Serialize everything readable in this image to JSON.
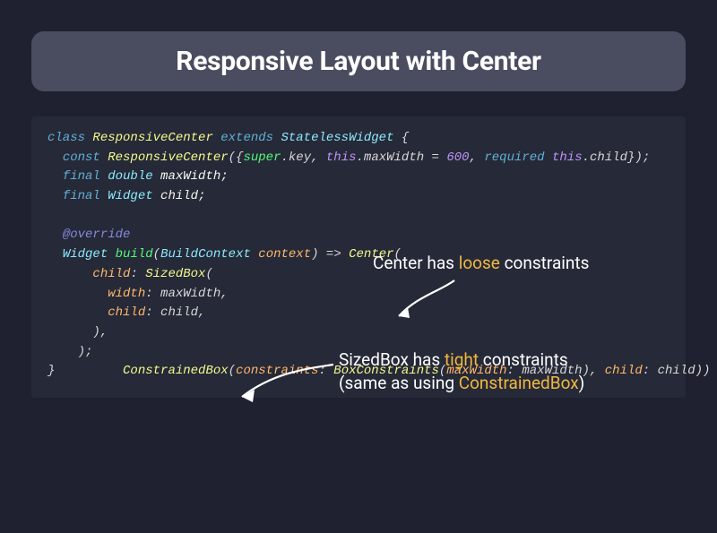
{
  "title": "Responsive Layout with Center",
  "code": {
    "l1_class": "class",
    "l1_name": "ResponsiveCenter",
    "l1_ext": "extends",
    "l1_super": "StatelessWidget",
    "l1_open": " {",
    "l2_const": "const",
    "l2_name": "ResponsiveCenter",
    "l2_open": "({",
    "l2_super": "super",
    "l2_dot_key": ".key, ",
    "l2_this1": "this",
    "l2_maxw": ".maxWidth = ",
    "l2_num": "600",
    "l2_comma": ", ",
    "l2_req": "required ",
    "l2_this2": "this",
    "l2_child": ".child});",
    "l3_final": "final",
    "l3_type": " double",
    "l3_name": " maxWidth;",
    "l4_final": "final",
    "l4_type": " Widget",
    "l4_name": " child;",
    "l6_ann": "@override",
    "l7_widget": "Widget",
    "l7_build": " build",
    "l7_open": "(",
    "l7_bctype": "BuildContext",
    "l7_ctx": " context",
    "l7_close": ") => ",
    "l7_center": "Center",
    "l7_p": "(",
    "l8_child": "child",
    "l8_colon": ": ",
    "l8_sized": "SizedBox",
    "l8_p": "(",
    "l9_width": "width",
    "l9_val": ": maxWidth,",
    "l10_child": "child",
    "l10_val": ": child,",
    "l11": "),",
    "l12": ");",
    "l13_brace": "}",
    "l13_cb": "ConstrainedBox",
    "l13_open": "(",
    "l13_cons": "constraints",
    "l13_colon1": ": ",
    "l13_bc": "BoxConstraints",
    "l13_open2": "(",
    "l13_mw": "maxWidth",
    "l13_val": ": maxWidth), ",
    "l13_child": "child",
    "l13_val2": ": child))"
  },
  "annotations": {
    "a1_pre": "Center has ",
    "a1_hl": "loose",
    "a1_post": " constraints",
    "a2_pre": "SizedBox has ",
    "a2_hl": "tight",
    "a2_post": " constraints",
    "a3_pre": "(same as using ",
    "a3_hl": "ConstrainedBox",
    "a3_post": ")"
  }
}
